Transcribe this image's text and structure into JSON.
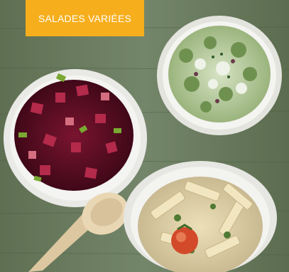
{
  "banner": {
    "label": "SALADES VARIÉES"
  },
  "colors": {
    "banner": "#f6ae1c",
    "banner_text": "#ffffff",
    "table_wood": "#6b7f5b"
  }
}
